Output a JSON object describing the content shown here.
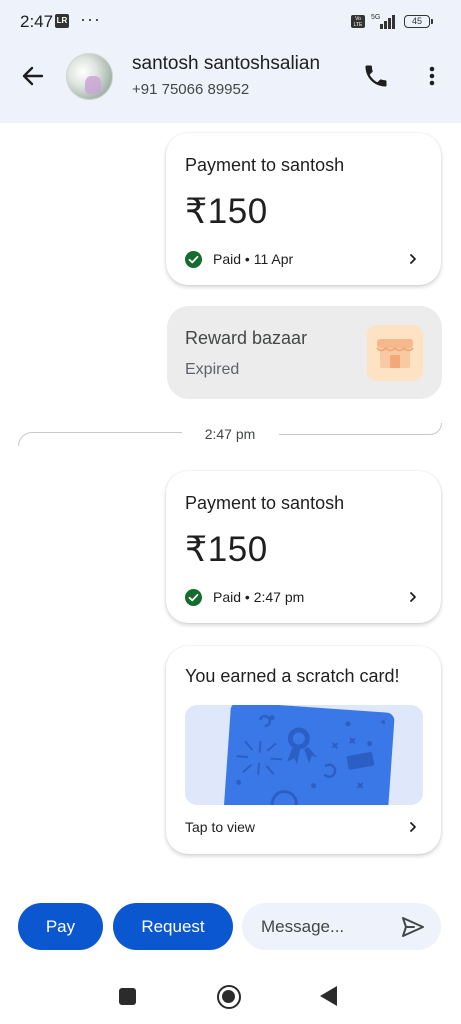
{
  "status_bar": {
    "time": "2:47",
    "app_icon": "LR",
    "overflow": "···",
    "network": "5G",
    "volte": "Vo LTE",
    "battery": "45"
  },
  "header": {
    "contact_name": "santosh santoshsalian",
    "contact_phone": "+91 75066 89952",
    "icons": [
      "arrow-back-icon",
      "phone-icon",
      "more-vert-icon"
    ]
  },
  "messages": [
    {
      "type": "payment",
      "title": "Payment to santosh",
      "amount": "₹150",
      "status": "Paid • 11 Apr"
    },
    {
      "type": "reward",
      "title": "Reward bazaar",
      "subtitle": "Expired"
    },
    {
      "type": "time_divider",
      "time": "2:47 pm"
    },
    {
      "type": "payment",
      "title": "Payment to santosh",
      "amount": "₹150",
      "status": "Paid • 2:47 pm"
    },
    {
      "type": "scratch_card",
      "title": "You earned a scratch card!",
      "action": "Tap to view"
    }
  ],
  "composer": {
    "pay_label": "Pay",
    "request_label": "Request",
    "message_placeholder": "Message..."
  },
  "colors": {
    "primary": "#0b57d0",
    "header_bg": "#eef2fb",
    "paid_green": "#146c2e",
    "scratch_blue": "#3b78e7"
  }
}
